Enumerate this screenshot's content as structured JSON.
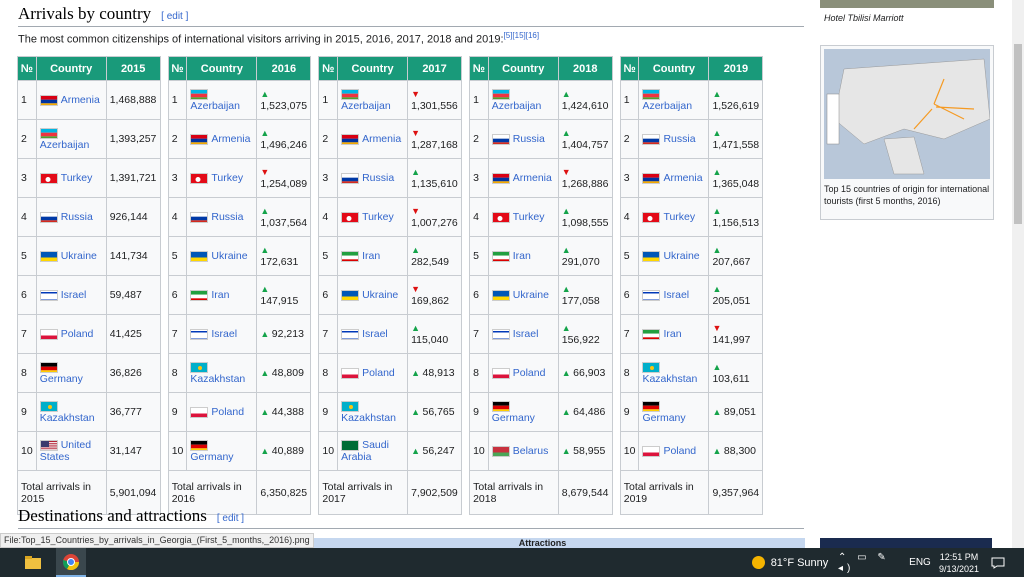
{
  "section1": {
    "title": "Arrivals by country",
    "edit": "[ edit ]"
  },
  "intro": {
    "text": "The most common citizenships of international visitors arriving in 2015, 2016, 2017, 2018 and 2019:",
    "refs": "[5][15][16]"
  },
  "headers": {
    "num": "№",
    "country": "Country"
  },
  "years": [
    {
      "year": "2015",
      "rows": [
        {
          "n": "1",
          "c": "Armenia",
          "f": "am",
          "v": "1,468,888",
          "t": ""
        },
        {
          "n": "2",
          "c": "Azerbaijan",
          "f": "az",
          "v": "1,393,257",
          "t": ""
        },
        {
          "n": "3",
          "c": "Turkey",
          "f": "tr",
          "v": "1,391,721",
          "t": ""
        },
        {
          "n": "4",
          "c": "Russia",
          "f": "ru",
          "v": "926,144",
          "t": ""
        },
        {
          "n": "5",
          "c": "Ukraine",
          "f": "ua",
          "v": "141,734",
          "t": ""
        },
        {
          "n": "6",
          "c": "Israel",
          "f": "il",
          "v": "59,487",
          "t": ""
        },
        {
          "n": "7",
          "c": "Poland",
          "f": "pl",
          "v": "41,425",
          "t": ""
        },
        {
          "n": "8",
          "c": "Germany",
          "f": "de",
          "v": "36,826",
          "t": ""
        },
        {
          "n": "9",
          "c": "Kazakhstan",
          "f": "kz",
          "v": "36,777",
          "t": ""
        },
        {
          "n": "10",
          "c": "United States",
          "f": "us",
          "v": "31,147",
          "t": ""
        }
      ],
      "total_label": "Total arrivals in 2015",
      "total": "5,901,094"
    },
    {
      "year": "2016",
      "rows": [
        {
          "n": "1",
          "c": "Azerbaijan",
          "f": "az",
          "v": "1,523,075",
          "t": "up"
        },
        {
          "n": "2",
          "c": "Armenia",
          "f": "am",
          "v": "1,496,246",
          "t": "up"
        },
        {
          "n": "3",
          "c": "Turkey",
          "f": "tr",
          "v": "1,254,089",
          "t": "dn"
        },
        {
          "n": "4",
          "c": "Russia",
          "f": "ru",
          "v": "1,037,564",
          "t": "up"
        },
        {
          "n": "5",
          "c": "Ukraine",
          "f": "ua",
          "v": "172,631",
          "t": "up"
        },
        {
          "n": "6",
          "c": "Iran",
          "f": "ir",
          "v": "147,915",
          "t": "up"
        },
        {
          "n": "7",
          "c": "Israel",
          "f": "il",
          "v": "92,213",
          "t": "up"
        },
        {
          "n": "8",
          "c": "Kazakhstan",
          "f": "kz",
          "v": "48,809",
          "t": "up"
        },
        {
          "n": "9",
          "c": "Poland",
          "f": "pl",
          "v": "44,388",
          "t": "up"
        },
        {
          "n": "10",
          "c": "Germany",
          "f": "de",
          "v": "40,889",
          "t": "up"
        }
      ],
      "total_label": "Total arrivals in 2016",
      "total": "6,350,825"
    },
    {
      "year": "2017",
      "rows": [
        {
          "n": "1",
          "c": "Azerbaijan",
          "f": "az",
          "v": "1,301,556",
          "t": "dn"
        },
        {
          "n": "2",
          "c": "Armenia",
          "f": "am",
          "v": "1,287,168",
          "t": "dn"
        },
        {
          "n": "3",
          "c": "Russia",
          "f": "ru",
          "v": "1,135,610",
          "t": "up"
        },
        {
          "n": "4",
          "c": "Turkey",
          "f": "tr",
          "v": "1,007,276",
          "t": "dn"
        },
        {
          "n": "5",
          "c": "Iran",
          "f": "ir",
          "v": "282,549",
          "t": "up"
        },
        {
          "n": "6",
          "c": "Ukraine",
          "f": "ua",
          "v": "169,862",
          "t": "dn"
        },
        {
          "n": "7",
          "c": "Israel",
          "f": "il",
          "v": "115,040",
          "t": "up"
        },
        {
          "n": "8",
          "c": "Poland",
          "f": "pl",
          "v": "48,913",
          "t": "up"
        },
        {
          "n": "9",
          "c": "Kazakhstan",
          "f": "kz",
          "v": "56,765",
          "t": "up"
        },
        {
          "n": "10",
          "c": "Saudi Arabia",
          "f": "sa",
          "v": "56,247",
          "t": "up"
        }
      ],
      "total_label": "Total arrivals in 2017",
      "total": "7,902,509"
    },
    {
      "year": "2018",
      "rows": [
        {
          "n": "1",
          "c": "Azerbaijan",
          "f": "az",
          "v": "1,424,610",
          "t": "up"
        },
        {
          "n": "2",
          "c": "Russia",
          "f": "ru",
          "v": "1,404,757",
          "t": "up"
        },
        {
          "n": "3",
          "c": "Armenia",
          "f": "am",
          "v": "1,268,886",
          "t": "dn"
        },
        {
          "n": "4",
          "c": "Turkey",
          "f": "tr",
          "v": "1,098,555",
          "t": "up"
        },
        {
          "n": "5",
          "c": "Iran",
          "f": "ir",
          "v": "291,070",
          "t": "up"
        },
        {
          "n": "6",
          "c": "Ukraine",
          "f": "ua",
          "v": "177,058",
          "t": "up"
        },
        {
          "n": "7",
          "c": "Israel",
          "f": "il",
          "v": "156,922",
          "t": "up"
        },
        {
          "n": "8",
          "c": "Poland",
          "f": "pl",
          "v": "66,903",
          "t": "up"
        },
        {
          "n": "9",
          "c": "Germany",
          "f": "de",
          "v": "64,486",
          "t": "up"
        },
        {
          "n": "10",
          "c": "Belarus",
          "f": "by",
          "v": "58,955",
          "t": "up"
        }
      ],
      "total_label": "Total arrivals in 2018",
      "total": "8,679,544"
    },
    {
      "year": "2019",
      "rows": [
        {
          "n": "1",
          "c": "Azerbaijan",
          "f": "az",
          "v": "1,526,619",
          "t": "up"
        },
        {
          "n": "2",
          "c": "Russia",
          "f": "ru",
          "v": "1,471,558",
          "t": "up"
        },
        {
          "n": "3",
          "c": "Armenia",
          "f": "am",
          "v": "1,365,048",
          "t": "up"
        },
        {
          "n": "4",
          "c": "Turkey",
          "f": "tr",
          "v": "1,156,513",
          "t": "up"
        },
        {
          "n": "5",
          "c": "Ukraine",
          "f": "ua",
          "v": "207,667",
          "t": "up"
        },
        {
          "n": "6",
          "c": "Israel",
          "f": "il",
          "v": "205,051",
          "t": "up"
        },
        {
          "n": "7",
          "c": "Iran",
          "f": "ir",
          "v": "141,997",
          "t": "dn"
        },
        {
          "n": "8",
          "c": "Kazakhstan",
          "f": "kz",
          "v": "103,611",
          "t": "up"
        },
        {
          "n": "9",
          "c": "Germany",
          "f": "de",
          "v": "89,051",
          "t": "up"
        },
        {
          "n": "10",
          "c": "Poland",
          "f": "pl",
          "v": "88,300",
          "t": "up"
        }
      ],
      "total_label": "Total arrivals in 2019",
      "total": "9,357,964"
    }
  ],
  "sidebar": {
    "hotel_caption": "Hotel Tbilisi Marriott",
    "map_caption": "Top 15 countries of origin for international tourists (first 5 months, 2016)"
  },
  "section2": {
    "title": "Destinations and attractions",
    "edit": "[ edit ]"
  },
  "status_bar": "File:Top_15_Countries_by_arrivals_in_Georgia_(First_5_months,_2016).png",
  "attractions_header": "Attractions",
  "taskbar": {
    "weather": "81°F  Sunny",
    "lang": "ENG",
    "time": "12:51 PM",
    "date": "9/13/2021"
  },
  "flag_colors": {
    "am": [
      "#d90012",
      "#0033a0",
      "#f2a800"
    ],
    "az": [
      "#00b5e2",
      "#ef3340",
      "#509e2f"
    ],
    "tr": [
      "#e30a17"
    ],
    "ru": [
      "#ffffff",
      "#0039a6",
      "#d52b1e"
    ],
    "ua": [
      "#0057b7",
      "#ffd700"
    ],
    "il": [
      "#ffffff",
      "#0038b8"
    ],
    "pl": [
      "#ffffff",
      "#dc143c"
    ],
    "de": [
      "#000000",
      "#dd0000",
      "#ffce00"
    ],
    "kz": [
      "#00afca"
    ],
    "us": [
      "#b22234",
      "#3c3b6e"
    ],
    "ir": [
      "#239f40",
      "#ffffff",
      "#da0000"
    ],
    "sa": [
      "#006c35"
    ],
    "by": [
      "#c8313e",
      "#4aa657"
    ]
  }
}
